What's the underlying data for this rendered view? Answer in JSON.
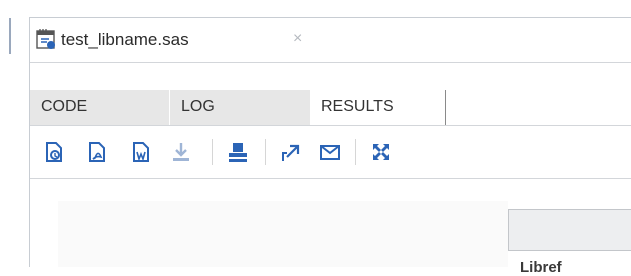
{
  "file": {
    "name": "test_libname.sas",
    "close_symbol": "×"
  },
  "tabs": [
    {
      "label": "CODE"
    },
    {
      "label": "LOG"
    },
    {
      "label": "RESULTS"
    }
  ],
  "toolbar": {
    "icons": [
      "download-html-icon",
      "download-pdf-icon",
      "download-word-icon",
      "download-icon",
      "print-icon",
      "open-in-new-window-icon",
      "email-icon",
      "maximize-icon"
    ]
  },
  "results": {
    "first_column_header": "Libref"
  },
  "colors": {
    "accent": "#2b64b6",
    "tab_bg": "#e7e7e7",
    "header_bg": "#edeef0"
  }
}
